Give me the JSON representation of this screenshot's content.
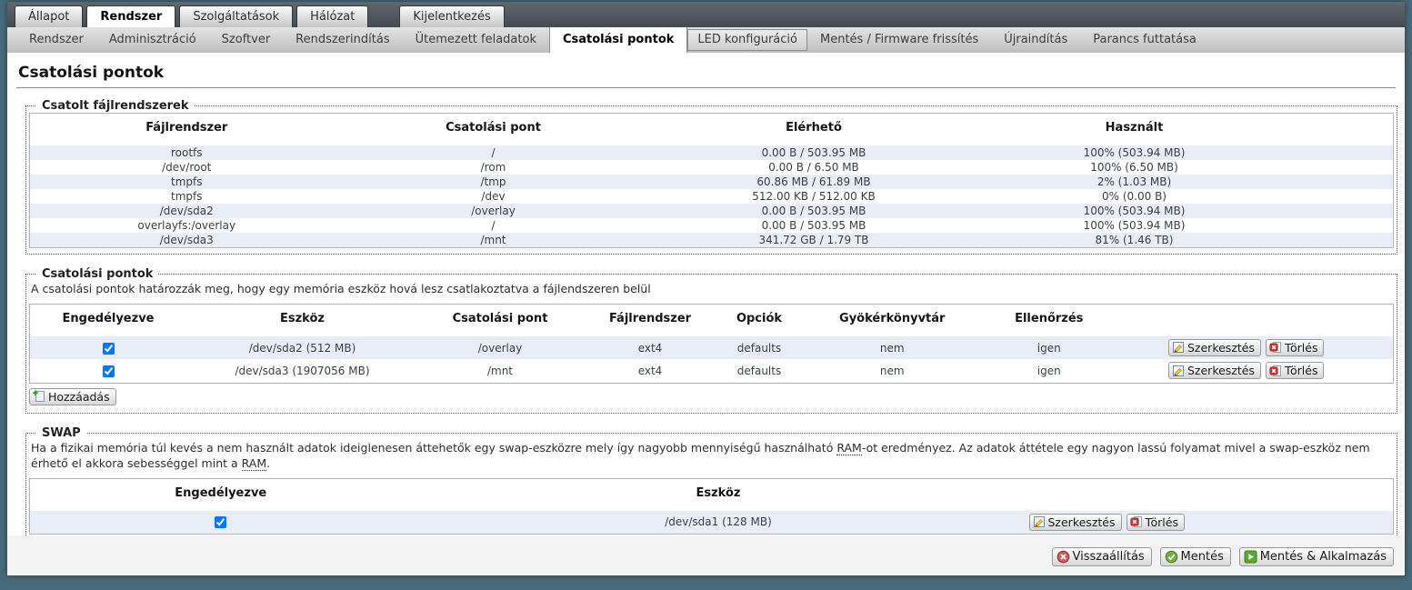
{
  "nav": {
    "main_tabs": [
      {
        "label": "Állapot",
        "active": false
      },
      {
        "label": "Rendszer",
        "active": true
      },
      {
        "label": "Szolgáltatások",
        "active": false
      },
      {
        "label": "Hálózat",
        "active": false
      },
      {
        "label": "Kijelentkezés",
        "active": false
      }
    ],
    "sub_tabs": [
      {
        "label": "Rendszer",
        "state": "normal"
      },
      {
        "label": "Adminisztráció",
        "state": "normal"
      },
      {
        "label": "Szoftver",
        "state": "normal"
      },
      {
        "label": "Rendszerindítás",
        "state": "normal"
      },
      {
        "label": "Ütemezett feladatok",
        "state": "normal"
      },
      {
        "label": "Csatolási pontok",
        "state": "active"
      },
      {
        "label": "LED konfiguráció",
        "state": "boxed"
      },
      {
        "label": "Mentés / Firmware frissítés",
        "state": "normal"
      },
      {
        "label": "Újraindítás",
        "state": "normal"
      },
      {
        "label": "Parancs futtatása",
        "state": "normal"
      }
    ]
  },
  "page": {
    "title": "Csatolási pontok"
  },
  "mounted_fs": {
    "legend": "Csatolt fájlrendszerek",
    "headers": [
      "Fájlrendszer",
      "Csatolási pont",
      "Elérhető",
      "Használt"
    ],
    "rows": [
      {
        "fs": "rootfs",
        "mount": "/",
        "avail": "0.00 B / 503.95 MB",
        "used": "100% (503.94 MB)"
      },
      {
        "fs": "/dev/root",
        "mount": "/rom",
        "avail": "0.00 B / 6.50 MB",
        "used": "100% (6.50 MB)"
      },
      {
        "fs": "tmpfs",
        "mount": "/tmp",
        "avail": "60.86 MB / 61.89 MB",
        "used": "2% (1.03 MB)"
      },
      {
        "fs": "tmpfs",
        "mount": "/dev",
        "avail": "512.00 KB / 512.00 KB",
        "used": "0% (0.00 B)"
      },
      {
        "fs": "/dev/sda2",
        "mount": "/overlay",
        "avail": "0.00 B / 503.95 MB",
        "used": "100% (503.94 MB)"
      },
      {
        "fs": "overlayfs:/overlay",
        "mount": "/",
        "avail": "0.00 B / 503.95 MB",
        "used": "100% (503.94 MB)"
      },
      {
        "fs": "/dev/sda3",
        "mount": "/mnt",
        "avail": "341.72 GB / 1.79 TB",
        "used": "81% (1.46 TB)"
      }
    ]
  },
  "mount_points": {
    "legend": "Csatolási pontok",
    "description": "A csatolási pontok határozzák meg, hogy egy memória eszköz hová lesz csatlakoztatva a fájlendszeren belül",
    "headers": [
      "Engedélyezve",
      "Eszköz",
      "Csatolási pont",
      "Fájlrendszer",
      "Opciók",
      "Gyökérkönyvtár",
      "Ellenőrzés"
    ],
    "rows": [
      {
        "enabled": true,
        "device": "/dev/sda2 (512 MB)",
        "mount": "/overlay",
        "fs": "ext4",
        "options": "defaults",
        "root": "nem",
        "check": "igen"
      },
      {
        "enabled": true,
        "device": "/dev/sda3 (1907056 MB)",
        "mount": "/mnt",
        "fs": "ext4",
        "options": "defaults",
        "root": "nem",
        "check": "igen"
      }
    ]
  },
  "swap": {
    "legend": "SWAP",
    "description_part1": "Ha a fizikai memória túl kevés a nem használt adatok ideiglenesen áttehetők egy swap-eszközre mely így nagyobb mennyiségű használható ",
    "ram1": "RAM",
    "description_part2": "-ot eredményez. Az adatok áttétele egy nagyon lassú folyamat mivel a swap-eszköz nem érhető el akkora sebességgel mint a ",
    "ram2": "RAM",
    "description_part3": ".",
    "headers": [
      "Engedélyezve",
      "Eszköz"
    ],
    "rows": [
      {
        "enabled": true,
        "device": "/dev/sda1 (128 MB)"
      }
    ]
  },
  "buttons": {
    "edit": "Szerkesztés",
    "delete": "Törlés",
    "add": "Hozzáadás"
  },
  "footer": {
    "reset": "Visszaállítás",
    "save": "Mentés",
    "apply": "Mentés & Alkalmazás"
  },
  "icons": {
    "edit": "pencil-on-page",
    "delete": "red-x-page",
    "add": "page-with-green-plus",
    "reset": "red-circle-x",
    "save": "green-circle-check",
    "apply": "green-square-arrow"
  },
  "colors": {
    "frame": "#476b7a",
    "row_stripe": "#e9edf6",
    "nav_dark": "#4a5157",
    "delete_red": "#cc3333",
    "save_green": "#6fae3f"
  }
}
